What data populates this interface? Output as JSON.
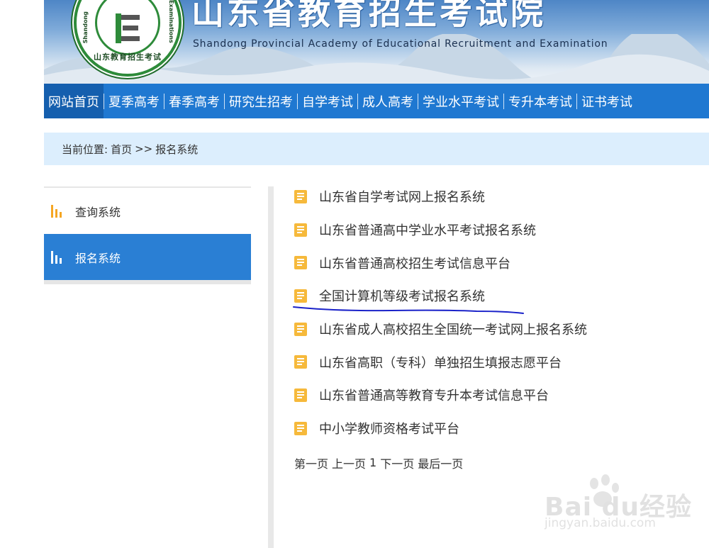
{
  "header": {
    "title": "山东省教育招生考试院",
    "subtitle": "Shandong Provincial Academy of Educational Recruitment and Examination",
    "logo": {
      "bottom_text": "山东教育招生考试",
      "side_text": "Shandong",
      "side_text_right": "Examinations"
    }
  },
  "nav": {
    "items": [
      {
        "label": "网站首页",
        "active": true
      },
      {
        "label": "夏季高考"
      },
      {
        "label": "春季高考"
      },
      {
        "label": "研究生招考"
      },
      {
        "label": "自学考试"
      },
      {
        "label": "成人高考"
      },
      {
        "label": "学业水平考试"
      },
      {
        "label": "专升本考试"
      },
      {
        "label": "证书考试"
      }
    ]
  },
  "breadcrumb": {
    "prefix": "当前位置:",
    "home": "首页",
    "sep": ">>",
    "current": "报名系统"
  },
  "sidebar": {
    "items": [
      {
        "label": "查询系统",
        "icon": "bar-chart-icon"
      },
      {
        "label": "报名系统",
        "icon": "bar-chart-icon",
        "active": true
      }
    ]
  },
  "list": {
    "items": [
      "山东省自学考试网上报名系统",
      "山东省普通高中学业水平考试报名系统",
      "山东省普通高校招生考试信息平台",
      "全国计算机等级考试报名系统",
      "山东省成人高校招生全国统一考试网上报名系统",
      "山东省高职（专科）单独招生填报志愿平台",
      "山东省普通高等教育专升本考试信息平台",
      "中小学教师资格考试平台"
    ]
  },
  "pager": {
    "first": "第一页",
    "prev": "上一页",
    "current": "1",
    "next": "下一页",
    "last": "最后一页"
  },
  "watermark": {
    "main": "Bai du经验",
    "sub": "jingyan.baidu.com"
  },
  "colors": {
    "nav_bg": "#1f78d1",
    "nav_active": "#155fae",
    "breadcrumb_bg": "#dceefd",
    "sidebar_active": "#2a7fd4",
    "doc_icon": "#f6b93b",
    "annotation": "#1a22c9"
  }
}
